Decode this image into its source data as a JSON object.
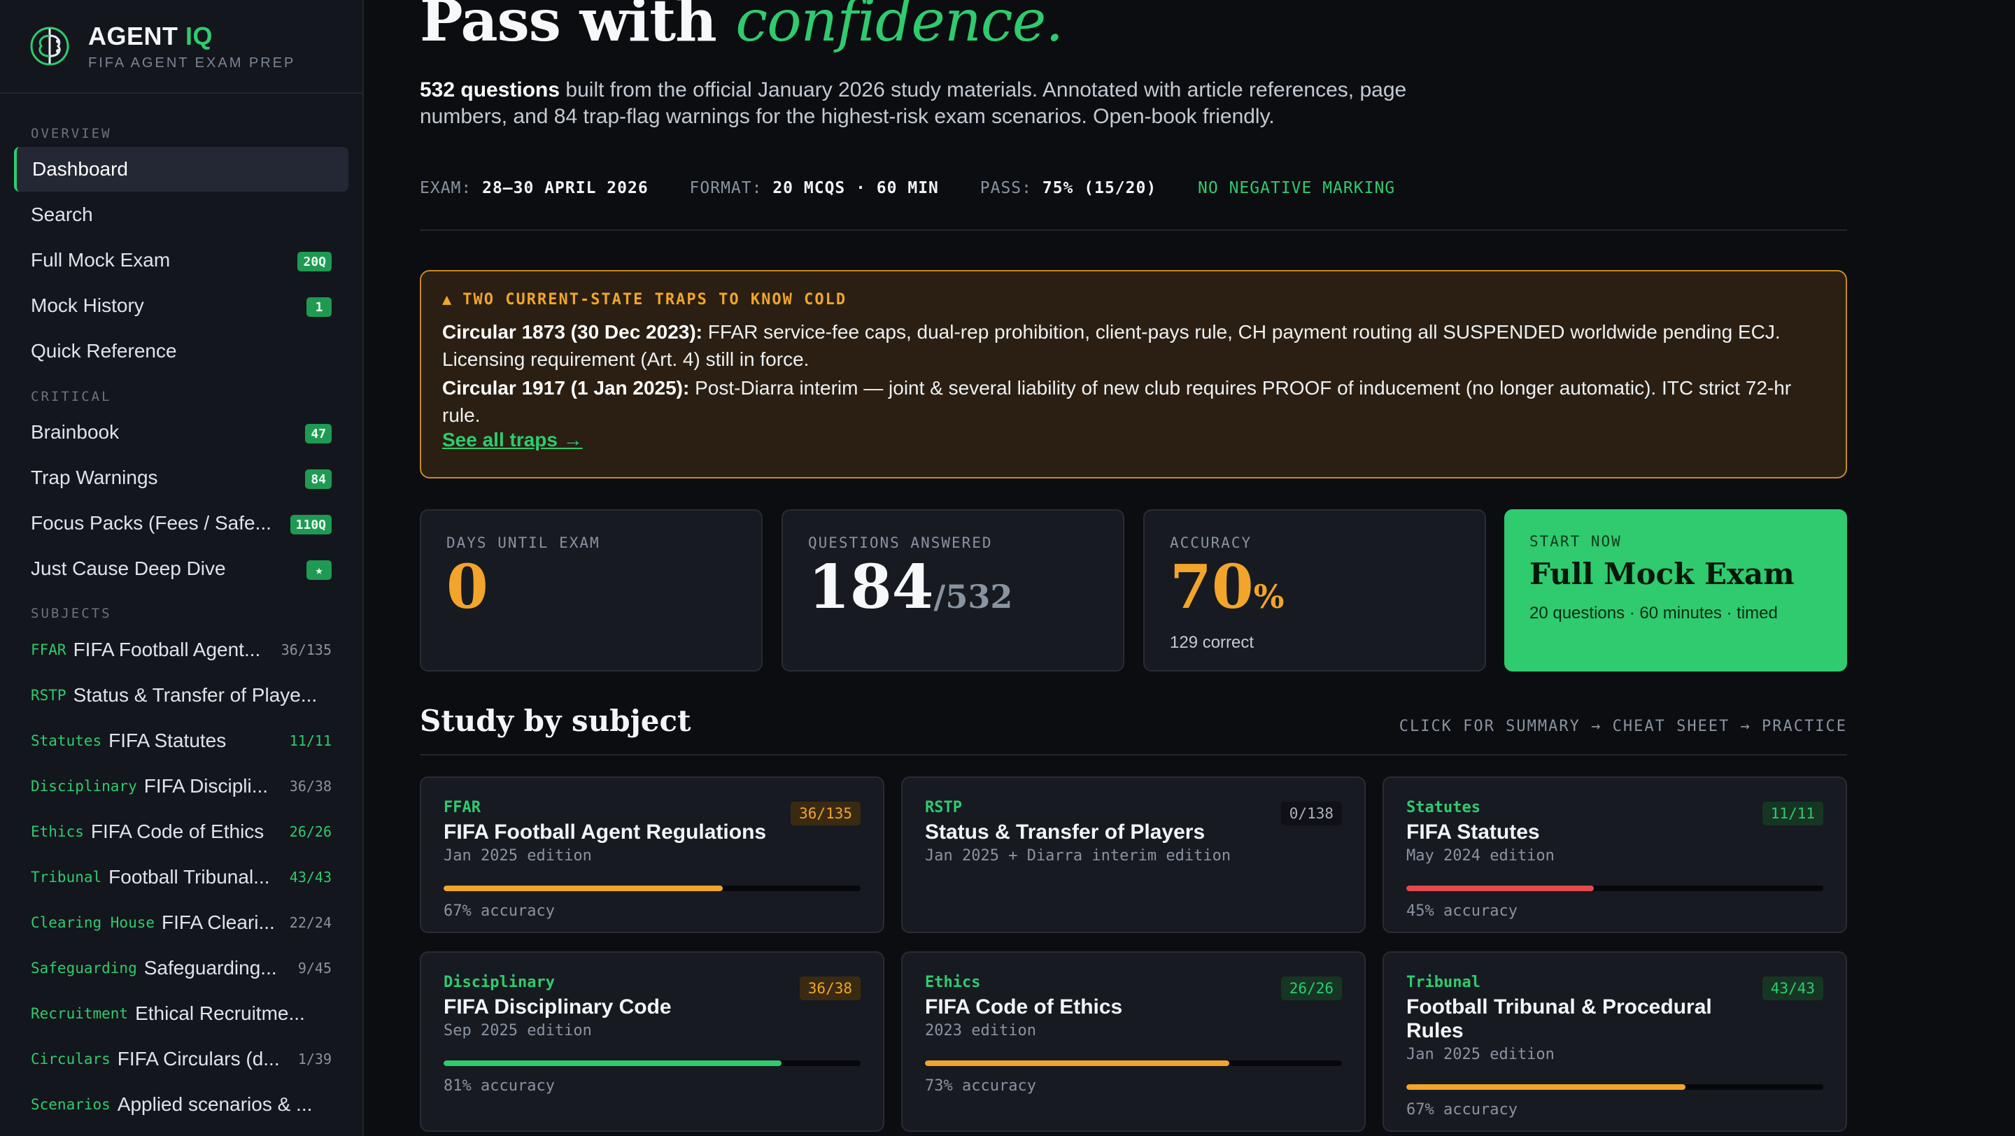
{
  "brand": {
    "name": "AGENT",
    "name_accent": "IQ",
    "subtitle": "FIFA AGENT EXAM PREP",
    "icon": "brain-icon"
  },
  "sidebar": {
    "overview_label": "OVERVIEW",
    "overview": [
      {
        "label": "Dashboard",
        "active": true
      },
      {
        "label": "Search"
      },
      {
        "label": "Full Mock Exam",
        "badge": "20Q"
      },
      {
        "label": "Mock History",
        "badge": "1"
      },
      {
        "label": "Quick Reference"
      }
    ],
    "critical_label": "CRITICAL",
    "critical": [
      {
        "label": "Brainbook",
        "badge": "47"
      },
      {
        "label": "Trap Warnings",
        "badge": "84"
      },
      {
        "label": "Focus Packs (Fees / Safe...",
        "badge": "110Q"
      },
      {
        "label": "Just Cause Deep Dive",
        "badge": "★"
      }
    ],
    "subjects_label": "SUBJECTS",
    "subjects": [
      {
        "code": "FFAR",
        "name": "FIFA Football Agent...",
        "count": "36/135"
      },
      {
        "code": "RSTP",
        "name": "Status & Transfer of Playe...",
        "count": ""
      },
      {
        "code": "Statutes",
        "name": "FIFA Statutes",
        "count": "11/11",
        "done": true
      },
      {
        "code": "Disciplinary",
        "name": "FIFA Discipli...",
        "count": "36/38"
      },
      {
        "code": "Ethics",
        "name": "FIFA Code of Ethics",
        "count": "26/26",
        "done": true
      },
      {
        "code": "Tribunal",
        "name": "Football Tribunal...",
        "count": "43/43",
        "done": true
      },
      {
        "code": "Clearing House",
        "name": "FIFA Cleari...",
        "count": "22/24"
      },
      {
        "code": "Safeguarding",
        "name": "Safeguarding...",
        "count": "9/45"
      },
      {
        "code": "Recruitment",
        "name": "Ethical Recruitme...",
        "count": ""
      },
      {
        "code": "Circulars",
        "name": "FIFA Circulars (d...",
        "count": "1/39"
      },
      {
        "code": "Scenarios",
        "name": "Applied scenarios & ...",
        "count": ""
      }
    ]
  },
  "hero": {
    "title": "Pass with",
    "title_accent": "confidence.",
    "desc_bold": "532 questions",
    "desc": " built from the official January 2026 study materials. Annotated with article references, page numbers, and 84 trap-flag warnings for the highest-risk exam scenarios. Open-book friendly.",
    "meta": {
      "exam_k": "EXAM:",
      "exam_v": "28–30 APRIL 2026",
      "format_k": "FORMAT:",
      "format_v": "20 MCQS · 60 MIN",
      "pass_k": "PASS:",
      "pass_v": "75% (15/20)",
      "note": "NO NEGATIVE MARKING"
    }
  },
  "traps": {
    "heading": "TWO CURRENT-STATE TRAPS TO KNOW COLD",
    "item1_bold": "Circular 1873 (30 Dec 2023):",
    "item1": " FFAR service-fee caps, dual-rep prohibition, client-pays rule, CH payment routing all SUSPENDED worldwide pending ECJ. Licensing requirement (Art. 4) still in force.",
    "item2_bold": "Circular 1917 (1 Jan 2025):",
    "item2": " Post-Diarra interim — joint & several liability of new club requires PROOF of inducement (no longer automatic). ITC strict 72-hr rule.",
    "link": "See all traps →"
  },
  "stats": {
    "days_label": "DAYS UNTIL EXAM",
    "days": "0",
    "answered_label": "QUESTIONS ANSWERED",
    "answered": "184",
    "answered_total": "/532",
    "accuracy_label": "ACCURACY",
    "accuracy": "70",
    "accuracy_unit": "%",
    "accuracy_sub": "129 correct",
    "cta_label": "START NOW",
    "cta_title": "Full Mock Exam",
    "cta_sub": "20 questions · 60 minutes · timed"
  },
  "study": {
    "title": "Study by subject",
    "hint": "CLICK FOR SUMMARY → CHEAT SHEET → PRACTICE",
    "cards": [
      {
        "code": "FFAR",
        "title": "FIFA Football Agent Regulations",
        "edition": "Jan 2025 edition",
        "badge": "36/135",
        "accuracy_text": "67% accuracy",
        "accuracy": 0.67,
        "color": "#f2a52a",
        "state": "partial"
      },
      {
        "code": "RSTP",
        "title": "Status & Transfer of Players",
        "edition": "Jan 2025 + Diarra interim edition",
        "badge": "0/138",
        "accuracy_text": "",
        "accuracy": 0,
        "color": "#f2a52a",
        "state": "none"
      },
      {
        "code": "Statutes",
        "title": "FIFA Statutes",
        "edition": "May 2024 edition",
        "badge": "11/11",
        "accuracy_text": "45% accuracy",
        "accuracy": 0.45,
        "color": "#e5484d",
        "state": "done"
      },
      {
        "code": "Disciplinary",
        "title": "FIFA Disciplinary Code",
        "edition": "Sep 2025 edition",
        "badge": "36/38",
        "accuracy_text": "81% accuracy",
        "accuracy": 0.81,
        "color": "#2fcb6e",
        "state": "partial"
      },
      {
        "code": "Ethics",
        "title": "FIFA Code of Ethics",
        "edition": "2023 edition",
        "badge": "26/26",
        "accuracy_text": "73% accuracy",
        "accuracy": 0.73,
        "color": "#f2a52a",
        "state": "done"
      },
      {
        "code": "Tribunal",
        "title": "Football Tribunal & Procedural Rules",
        "edition": "Jan 2025 edition",
        "badge": "43/43",
        "accuracy_text": "67% accuracy",
        "accuracy": 0.67,
        "color": "#f2a52a",
        "state": "done"
      }
    ]
  }
}
